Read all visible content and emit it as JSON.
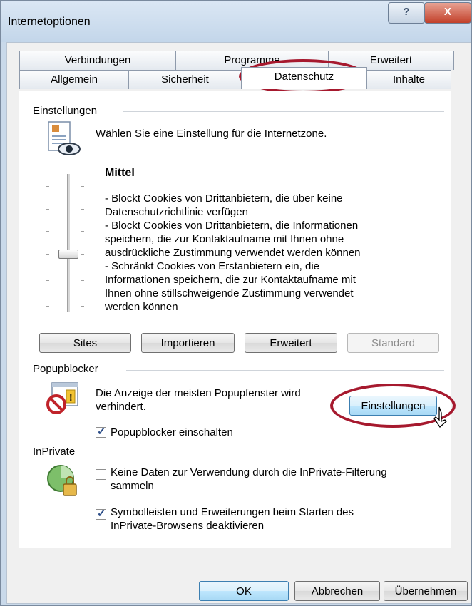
{
  "window": {
    "title": "Internetoptionen",
    "help_glyph": "?",
    "close_glyph": "X"
  },
  "tabs": {
    "row1": [
      {
        "label": "Verbindungen"
      },
      {
        "label": "Programme"
      },
      {
        "label": "Erweitert"
      }
    ],
    "row2": [
      {
        "label": "Allgemein"
      },
      {
        "label": "Sicherheit"
      },
      {
        "label": "Datenschutz",
        "active": true
      },
      {
        "label": "Inhalte"
      }
    ]
  },
  "settings": {
    "section_label": "Einstellungen",
    "intro": "Wählen Sie eine Einstellung für die Internetzone.",
    "level_title": "Mittel",
    "description_lines": [
      "- Blockt Cookies von Drittanbietern, die über keine",
      "Datenschutzrichtlinie verfügen",
      "- Blockt Cookies von Drittanbietern, die Informationen",
      "speichern, die zur Kontaktaufname mit Ihnen ohne",
      "ausdrückliche Zustimmung verwendet werden können",
      "- Schränkt Cookies von Erstanbietern ein, die",
      "Informationen speichern, die zur Kontaktaufname mit",
      "Ihnen ohne stillschweigende Zustimmung verwendet",
      "werden können"
    ],
    "buttons": {
      "sites": "Sites",
      "import": "Importieren",
      "advanced": "Erweitert",
      "default": "Standard"
    }
  },
  "popup": {
    "section_label": "Popupblocker",
    "description_line1": "Die Anzeige der meisten Popupfenster wird",
    "description_line2": "verhindert.",
    "settings_button": "Einstellungen",
    "checkbox_label": "Popupblocker einschalten",
    "checkbox_checked": true
  },
  "inprivate": {
    "section_label": "InPrivate",
    "option1_line1": "Keine Daten zur Verwendung durch die InPrivate-Filterung",
    "option1_line2": "sammeln",
    "option1_checked": false,
    "option2_line1": "Symbolleisten und Erweiterungen beim Starten des",
    "option2_line2": "InPrivate-Browsens deaktivieren",
    "option2_checked": true
  },
  "footer": {
    "ok": "OK",
    "cancel": "Abbrechen",
    "apply": "Übernehmen"
  },
  "colors": {
    "highlight_circle": "#a6192e",
    "titlebar": "#c9d9ea",
    "close_button": "#c2402a"
  }
}
